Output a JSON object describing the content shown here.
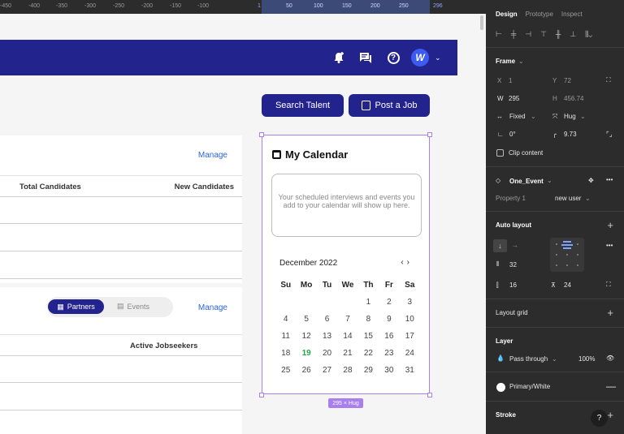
{
  "ruler": {
    "ticks": [
      "-450",
      "-400",
      "-350",
      "-300",
      "-250",
      "-200",
      "-150",
      "-100",
      "1",
      "50",
      "100",
      "150",
      "200",
      "250",
      "296"
    ]
  },
  "app": {
    "header": {
      "bell_icon": "bell-plus-icon",
      "chat_icon": "chat-icon",
      "help_icon": "help-circle-icon",
      "avatar_letter": "W"
    },
    "buttons": {
      "search_talent": "Search Talent",
      "post_job": "Post a Job"
    },
    "card1": {
      "manage": "Manage",
      "col1": "Total Candidates",
      "col2": "New Candidates"
    },
    "card2": {
      "manage": "Manage",
      "seg_on": "Partners",
      "seg_off": "Events",
      "col1": "Active Jobseekers"
    },
    "calendar": {
      "title": "My Calendar",
      "empty_text": "Your scheduled interviews and events you add to your calendar will show up here.",
      "month": "December 2022",
      "prev": "‹",
      "next": "›",
      "weekdays": [
        "Su",
        "Mo",
        "Tu",
        "We",
        "Th",
        "Fr",
        "Sa"
      ],
      "days": [
        "",
        "",
        "",
        "",
        "1",
        "2",
        "3",
        "4",
        "5",
        "6",
        "7",
        "8",
        "9",
        "10",
        "11",
        "12",
        "13",
        "14",
        "15",
        "16",
        "17",
        "18",
        "19",
        "20",
        "21",
        "22",
        "23",
        "24",
        "25",
        "26",
        "27",
        "28",
        "29",
        "30",
        "31"
      ],
      "today": "19",
      "size_tag": "295 × Hug"
    }
  },
  "panel": {
    "tabs": [
      "Design",
      "Prototype",
      "Inspect"
    ],
    "frame": {
      "title": "Frame",
      "x_label": "X",
      "x_value": "1",
      "y_label": "Y",
      "y_value": "72",
      "w_label": "W",
      "w_value": "295",
      "h_label": "H",
      "h_value": "456.74",
      "width_mode": "Fixed",
      "height_mode": "Hug",
      "rotation": "0°",
      "radius": "9.73",
      "clip": "Clip content"
    },
    "component": {
      "name": "One_Event",
      "prop_label": "Property 1",
      "prop_value": "new user"
    },
    "auto_layout": {
      "title": "Auto layout",
      "spacing": "32",
      "padding_h": "16",
      "padding_v": "24"
    },
    "layout_grid": "Layout grid",
    "layer": {
      "title": "Layer",
      "blend": "Pass through",
      "opacity": "100%"
    },
    "fill": "Primary/White",
    "stroke": "Stroke",
    "help": "?"
  },
  "colors": {
    "brand": "#23238e",
    "link": "#2b64e0",
    "selection": "#a97ff0",
    "today": "#29a745"
  }
}
